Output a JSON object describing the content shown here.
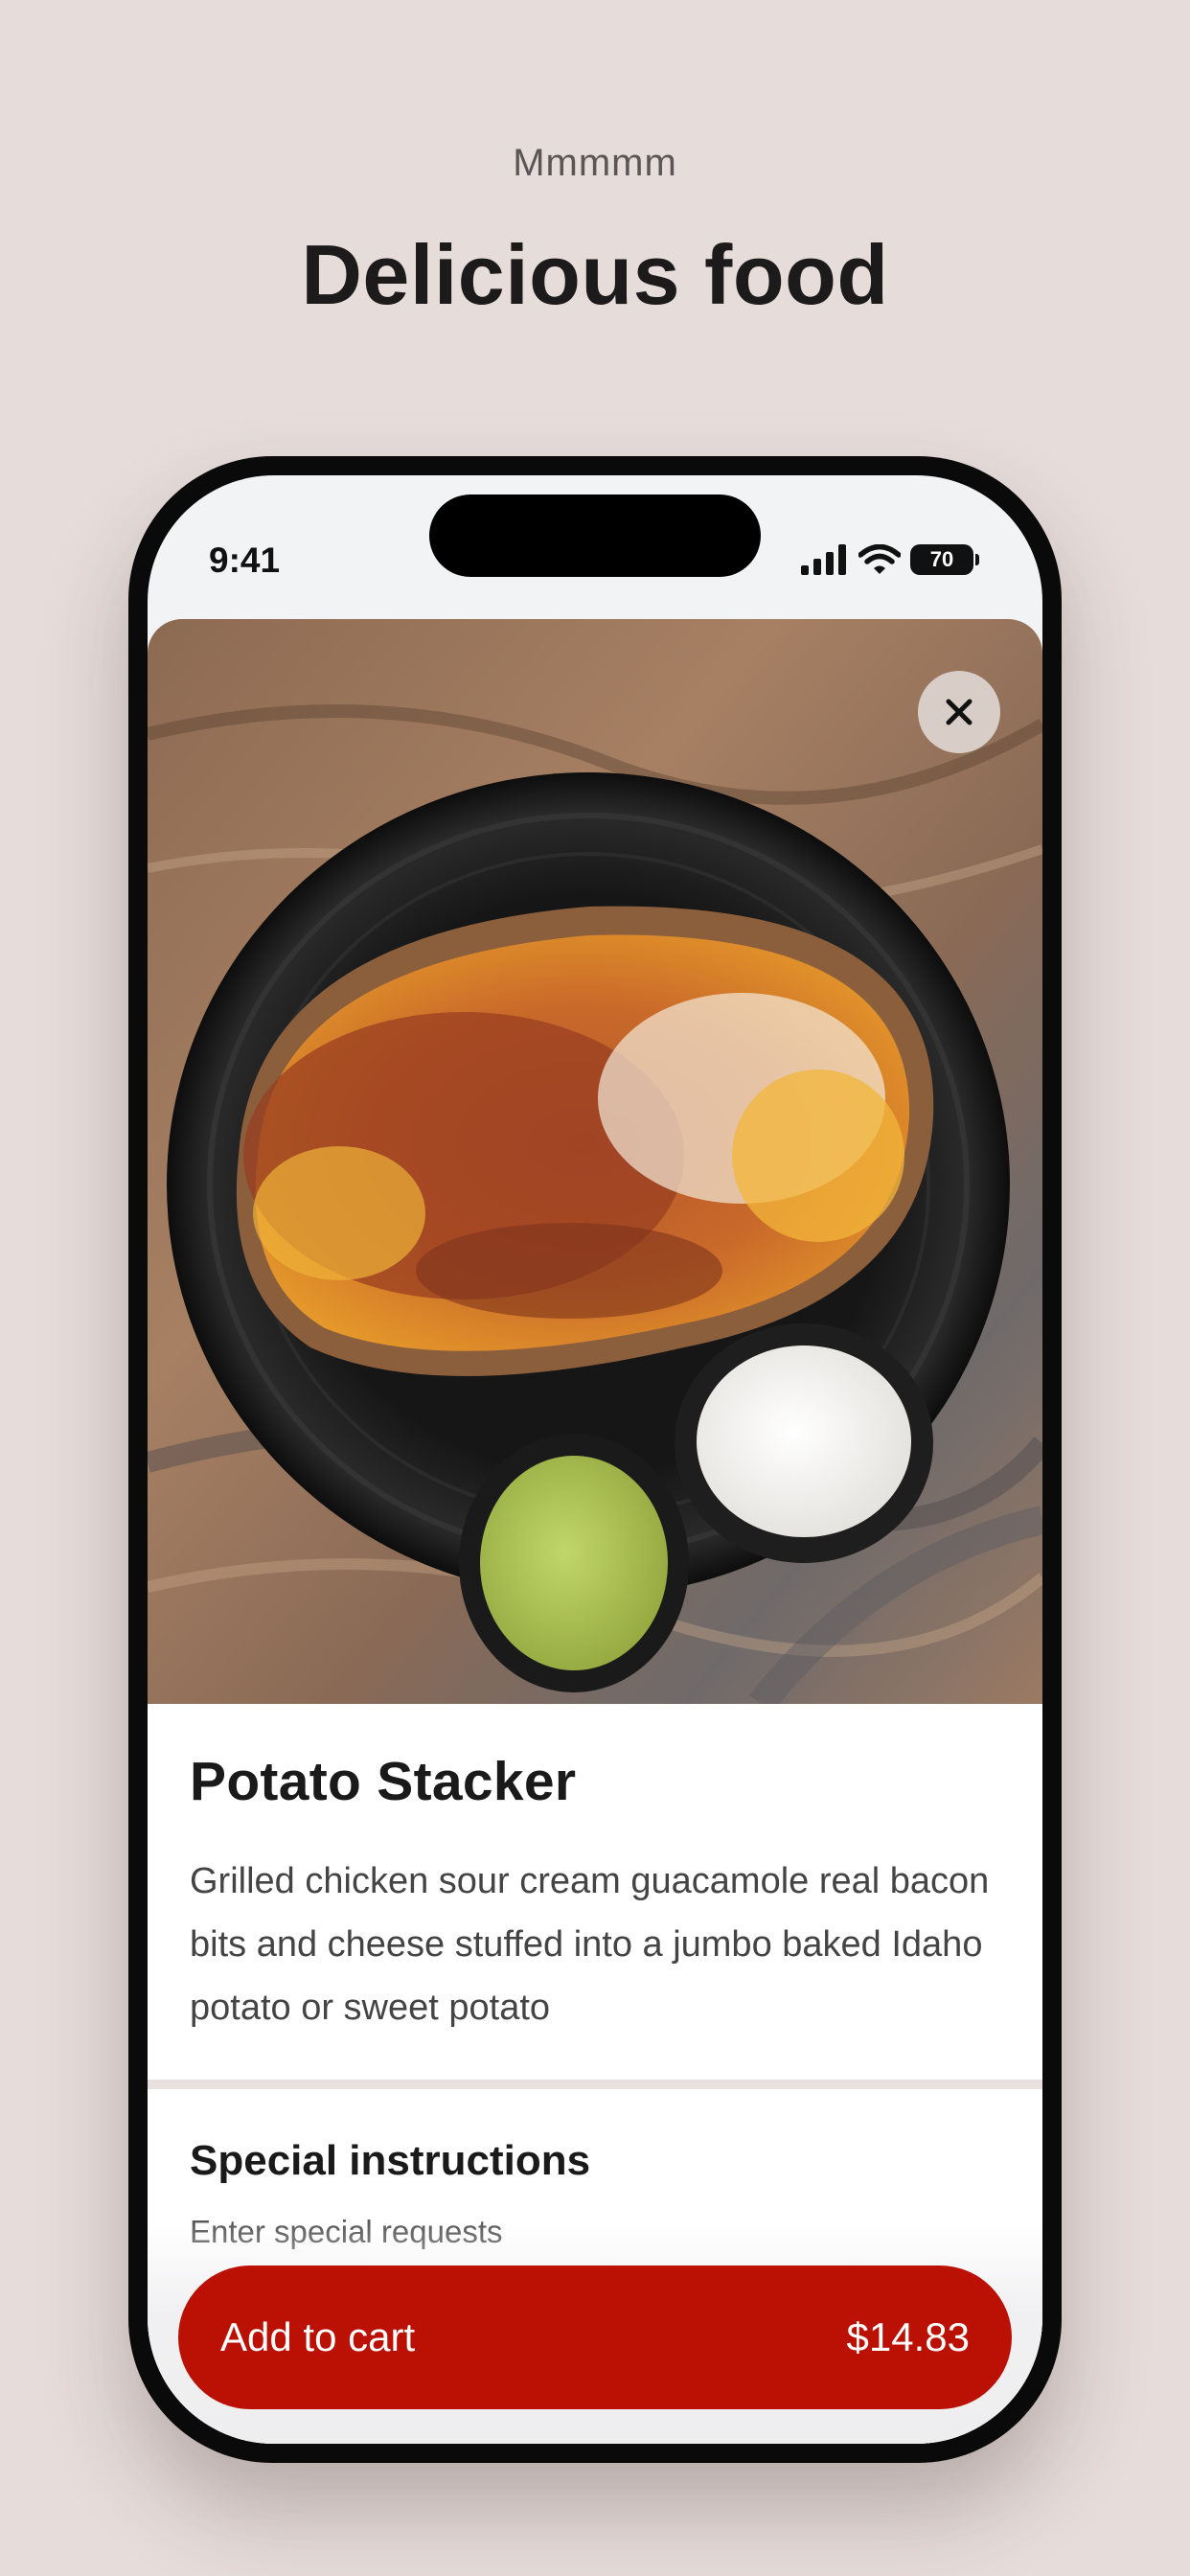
{
  "header": {
    "eyebrow": "Mmmmm",
    "headline": "Delicious food"
  },
  "status_bar": {
    "time": "9:41",
    "battery": "70",
    "icons": [
      "cellular-signal-icon",
      "wifi-icon",
      "battery-icon"
    ]
  },
  "item": {
    "photo": "baked-potato-photo",
    "close_icon": "close-icon",
    "title": "Potato Stacker",
    "description": "Grilled chicken sour cream guacamole real bacon bits and cheese stuffed into a jumbo baked Idaho potato or sweet potato"
  },
  "instructions": {
    "title": "Special instructions",
    "placeholder": "Enter special requests"
  },
  "cart": {
    "label": "Add to cart",
    "price": "$14.83"
  },
  "colors": {
    "background": "#e6dcda",
    "accent": "#bb1104",
    "phone_frame": "#0a0a0a"
  }
}
